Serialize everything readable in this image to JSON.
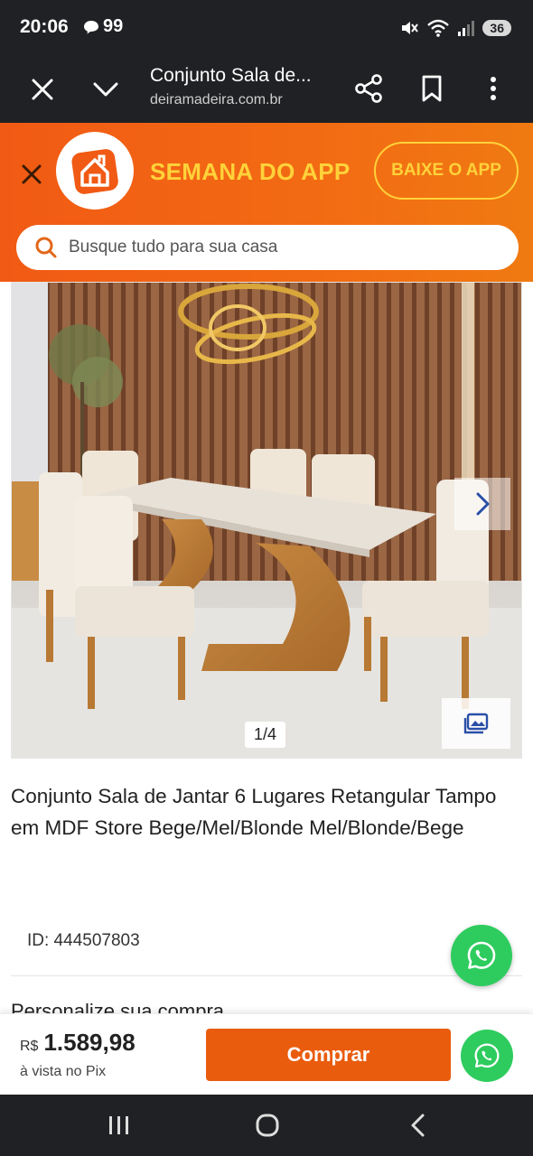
{
  "status_bar": {
    "time": "20:06",
    "notification_count": "99",
    "battery": "36"
  },
  "browser": {
    "page_title": "Conjunto Sala de...",
    "url": "deiramadeira.com.br"
  },
  "promo_header": {
    "promo_text": "SEMANA DO APP",
    "app_button": "BAIXE O APP",
    "brand_color": "#f15a14",
    "accent_color": "#ffd23a"
  },
  "search": {
    "placeholder": "Busque tudo para sua casa"
  },
  "gallery": {
    "counter": "1/4"
  },
  "product": {
    "title": "Conjunto Sala de Jantar 6 Lugares Retangular Tampo em MDF Store Bege/Mel/Blonde Mel/Blonde/Bege",
    "id_label": "ID: 444507803",
    "personalize_heading": "Personalize sua compra"
  },
  "purchase": {
    "currency": "R$",
    "price": "1.589,98",
    "price_note": "à vista no Pix",
    "buy_label": "Comprar",
    "buy_color": "#ea5c0d",
    "whatsapp_color": "#2ecc5e"
  },
  "icons": {
    "close": "close-icon",
    "chevron": "chevron-down-icon",
    "share": "share-icon",
    "bookmark": "bookmark-icon",
    "menu": "more-vert-icon",
    "search": "search-icon",
    "whatsapp": "whatsapp-icon",
    "gallery_next": "chevron-right-icon",
    "gallery_photos": "image-gallery-icon"
  }
}
